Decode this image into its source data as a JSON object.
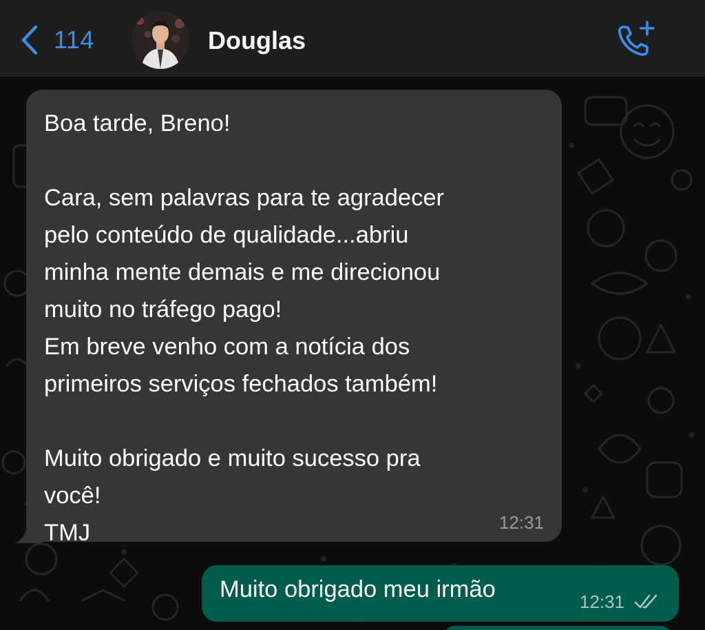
{
  "header": {
    "back_count": "114",
    "contact_name": "Douglas",
    "icons": {
      "back": "chevron-left-icon",
      "call": "phone-add-icon",
      "avatar": "contact-avatar"
    },
    "accent_color": "#3b8ef0"
  },
  "messages": [
    {
      "direction": "incoming",
      "text": "Boa tarde, Breno!\n\nCara, sem palavras para te agradecer\npelo conteúdo de qualidade...abriu\nminha mente demais e me direcionou\nmuito no tráfego pago!\nEm breve venho com a notícia dos\nprimeiros serviços fechados também!\n\nMuito obrigado e muito sucesso pra\nvocê!\nTMJ",
      "time": "12:31",
      "bubble_color": "#363638"
    },
    {
      "direction": "outgoing",
      "text": "Muito obrigado meu irmão",
      "time": "12:31",
      "status": "read",
      "status_icon": "double-check-icon",
      "bubble_color": "#005c4b"
    }
  ]
}
